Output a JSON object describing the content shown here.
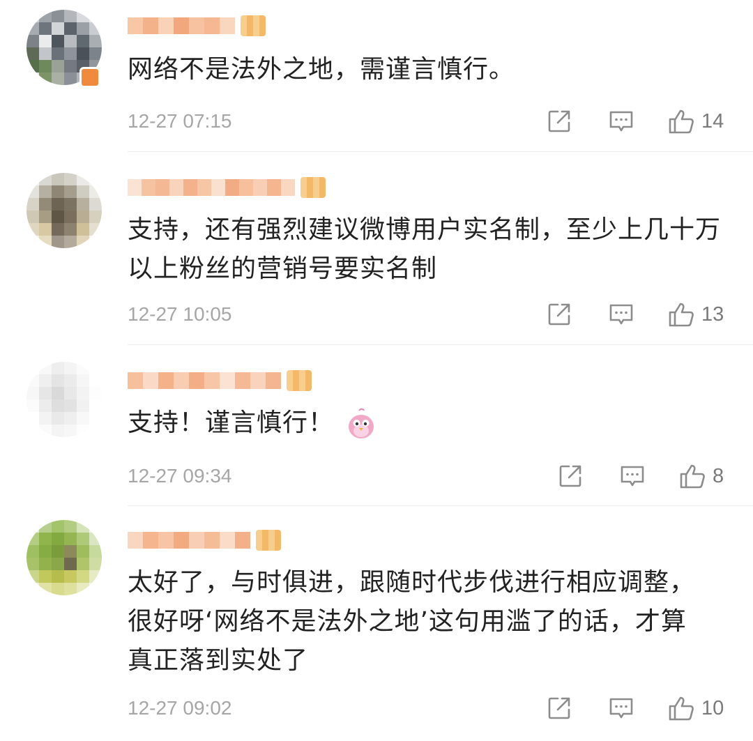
{
  "comments": [
    {
      "text": "网络不是法外之地，需谨言慎行。",
      "time": "12-27 07:15",
      "likes": "14",
      "icons": [
        "share-icon",
        "comment-icon",
        "thumbs-up-icon"
      ]
    },
    {
      "text": "支持，还有强烈建议微博用户实名制，至少上几十万以上粉丝的营销号要实名制",
      "time": "12-27 10:05",
      "likes": "13",
      "icons": [
        "share-icon",
        "comment-icon",
        "thumbs-up-icon"
      ]
    },
    {
      "text": "支持！谨言慎行！",
      "emoji": "pink-bird-emoji",
      "time": "12-27 09:34",
      "likes": "8",
      "icons": [
        "share-icon",
        "comment-icon",
        "thumbs-up-icon"
      ]
    },
    {
      "text": "太好了，与时俱进，跟随时代步伐进行相应调整，很好呀‘网络不是法外之地’这句用滥了的话，才算真正落到实处了",
      "time": "12-27 09:02",
      "likes": "10",
      "icons": [
        "share-icon",
        "comment-icon",
        "thumbs-up-icon"
      ]
    }
  ],
  "colors": {
    "text": "#222222",
    "meta": "#a6a6a6",
    "divider": "#ececec",
    "nickname_blur": "#f5b88e",
    "icon": "#8c8c8c"
  }
}
